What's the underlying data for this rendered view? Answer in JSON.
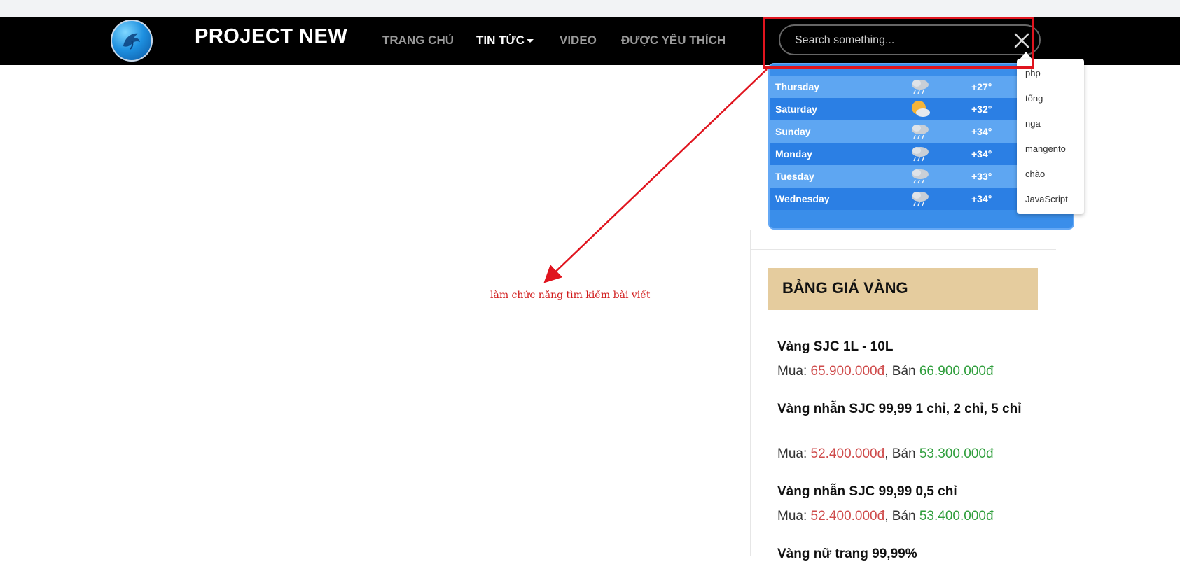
{
  "navbar": {
    "brand": "PROJECT NEW",
    "items": [
      {
        "label": "TRANG CHỦ",
        "active": false
      },
      {
        "label": "TIN TỨC",
        "active": true,
        "dropdown": true
      },
      {
        "label": "VIDEO",
        "active": false
      },
      {
        "label": "ĐƯỢC YÊU THÍCH",
        "active": false
      }
    ]
  },
  "search": {
    "placeholder": "Search something...",
    "value": "",
    "close_icon": "close-icon",
    "suggestions": [
      "php",
      "tổng",
      "nga",
      "mangento",
      "chào",
      "JavaScript"
    ]
  },
  "weather": {
    "rows": [
      {
        "day": "Thursday",
        "icon": "rain-cloud-icon",
        "temp": "+27°"
      },
      {
        "day": "Saturday",
        "icon": "sun-cloud-icon",
        "temp": "+32°"
      },
      {
        "day": "Sunday",
        "icon": "rain-cloud-icon",
        "temp": "+34°"
      },
      {
        "day": "Monday",
        "icon": "rain-cloud-icon",
        "temp": "+34°"
      },
      {
        "day": "Tuesday",
        "icon": "rain-cloud-icon",
        "temp": "+33°"
      },
      {
        "day": "Wednesday",
        "icon": "rain-cloud-icon",
        "temp": "+34°"
      }
    ]
  },
  "gold": {
    "title": "BẢNG GIÁ VÀNG",
    "buy_label": "Mua:",
    "sell_label": "Bán",
    "items": [
      {
        "name": "Vàng SJC 1L - 10L",
        "buy": "65.900.000đ",
        "sell": "66.900.000đ"
      },
      {
        "name": "Vàng nhẫn SJC 99,99 1 chỉ, 2 chỉ, 5 chỉ",
        "buy": "52.400.000đ",
        "sell": "53.300.000đ"
      },
      {
        "name": "Vàng nhẫn SJC 99,99 0,5 chỉ",
        "buy": "52.400.000đ",
        "sell": "53.400.000đ"
      },
      {
        "name": "Vàng nữ trang 99,99%"
      }
    ]
  },
  "annotation": {
    "text": "làm chức năng tìm kiếm bài viết"
  },
  "colors": {
    "navbar_bg": "#000000",
    "highlight": "#e0141e",
    "weather_bg": "#3a8eea",
    "gold_header_bg": "#e5cc9e",
    "buy_price": "#cf4b4b",
    "sell_price": "#2f9e3c"
  }
}
